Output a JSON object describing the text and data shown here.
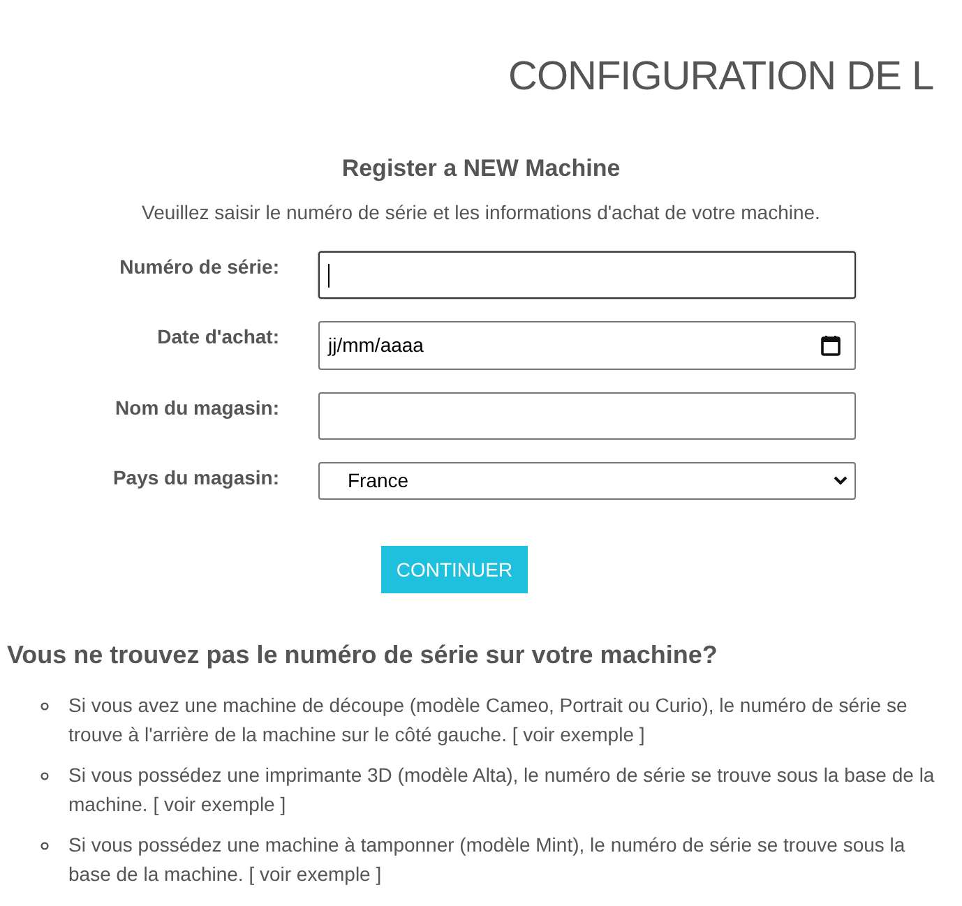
{
  "page_title": "CONFIGURATION DE L",
  "form": {
    "title": "Register a NEW Machine",
    "intro": "Veuillez saisir le numéro de série et les informations d'achat de votre machine.",
    "fields": [
      {
        "kind": "text",
        "label": "Numéro de série:",
        "focused": true
      },
      {
        "kind": "date",
        "label": "Date d'achat:",
        "placeholder": "jj/mm/aaaa"
      },
      {
        "kind": "text",
        "label": "Nom du magasin:",
        "focused": false
      },
      {
        "kind": "select",
        "label": "Pays du magasin:",
        "value": "France"
      }
    ],
    "submit": "CONTINUER"
  },
  "help": {
    "title": "Vous ne trouvez pas le numéro de série sur votre machine?",
    "items": [
      {
        "text": "Si vous avez une machine de découpe (modèle Cameo, Portrait ou Curio), le numéro de série se trouve à l'arrière de la machine sur le côté gauche.",
        "link": "[ voir exemple ]"
      },
      {
        "text": "Si vous possédez une imprimante 3D (modèle Alta), le numéro de série se trouve sous la base de la machine.",
        "link": "[ voir exemple ]"
      },
      {
        "text": "Si vous possédez une machine à tamponner (modèle Mint), le numéro de série se trouve sous la base de la machine.",
        "link": "[ voir exemple ]"
      }
    ]
  }
}
